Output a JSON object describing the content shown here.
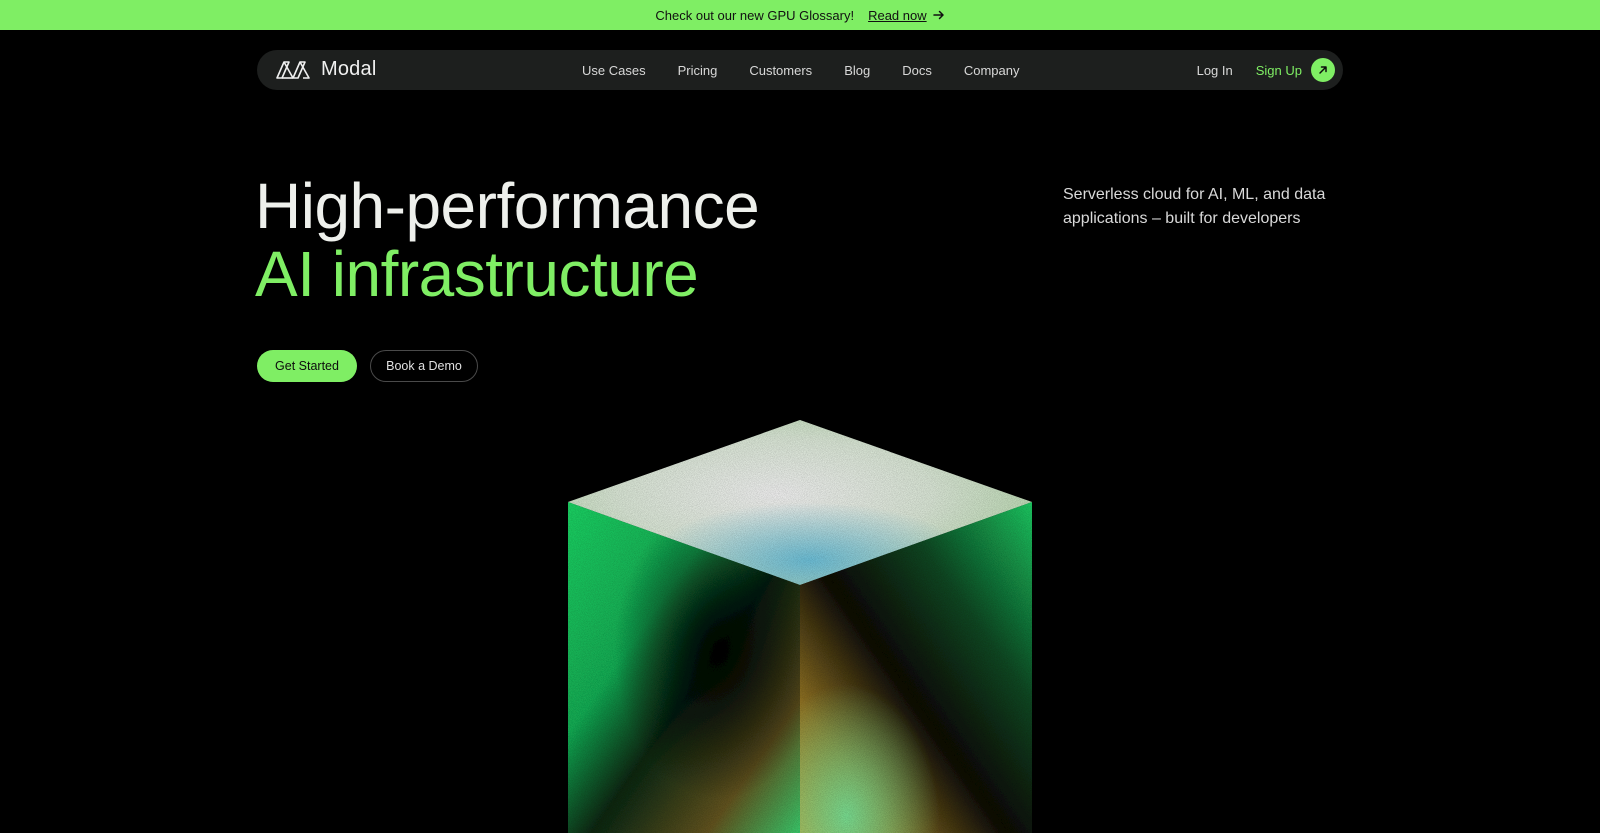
{
  "banner": {
    "message": "Check out our new GPU Glossary!",
    "link_label": "Read now",
    "link_icon": "arrow-right-icon"
  },
  "nav": {
    "logo_text": "Modal",
    "logo_icon": "modal-logo-icon",
    "links": [
      "Use Cases",
      "Pricing",
      "Customers",
      "Blog",
      "Docs",
      "Company"
    ],
    "login_label": "Log In",
    "signup_label": "Sign Up",
    "signup_icon": "arrow-up-right-icon"
  },
  "hero": {
    "title_line1": "High-performance",
    "title_line2": "AI infrastructure",
    "tagline": "Serverless cloud for AI, ML, and data applications – built for developers",
    "primary_cta": "Get Started",
    "secondary_cta": "Book a Demo"
  },
  "colors": {
    "accent": "#7fee64",
    "background": "#000000",
    "nav_bg": "#1d1f1e"
  }
}
